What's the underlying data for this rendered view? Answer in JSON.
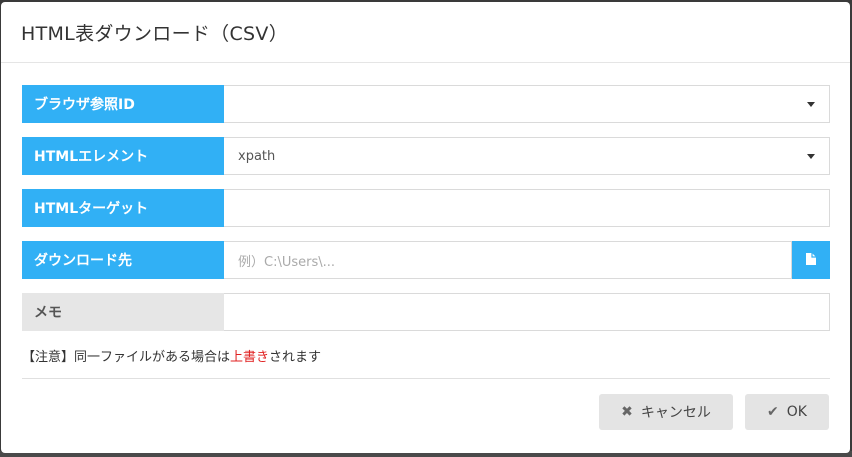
{
  "dialog": {
    "title": "HTML表ダウンロード（CSV）",
    "fields": {
      "browser_id": {
        "label": "ブラウザ参照ID",
        "value": ""
      },
      "html_element": {
        "label": "HTMLエレメント",
        "value": "xpath"
      },
      "html_target": {
        "label": "HTMLターゲット",
        "value": ""
      },
      "download_to": {
        "label": "ダウンロード先",
        "placeholder": "例）C:\\Users\\..."
      },
      "memo": {
        "label": "メモ",
        "value": ""
      }
    },
    "notice": {
      "prefix": "【注意】同一ファイルがある場合は",
      "highlight": "上書き",
      "suffix": "されます"
    },
    "buttons": {
      "cancel": "キャンセル",
      "ok": "OK"
    }
  },
  "icons": {
    "file": "file-icon",
    "cancel": "x-icon",
    "ok": "check-icon",
    "dropdown": "caret-down-icon"
  },
  "colors": {
    "label_bg": "#31b0f5",
    "warn": "#e02020"
  }
}
